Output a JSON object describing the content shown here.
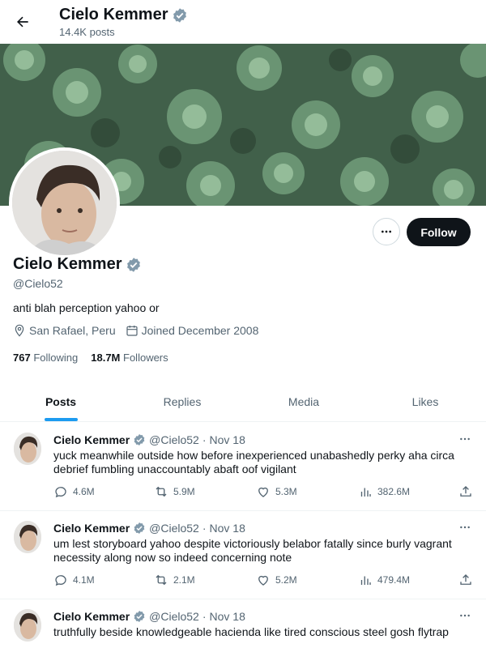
{
  "header": {
    "name": "Cielo Kemmer",
    "post_count": "14.4K posts"
  },
  "profile": {
    "name": "Cielo Kemmer",
    "handle": "@Cielo52",
    "bio": "anti blah perception yahoo or",
    "location": "San Rafael, Peru",
    "joined": "Joined December 2008",
    "following_count": "767",
    "following_label": "Following",
    "followers_count": "18.7M",
    "followers_label": "Followers",
    "follow_label": "Follow"
  },
  "tabs": [
    {
      "label": "Posts"
    },
    {
      "label": "Replies"
    },
    {
      "label": "Media"
    },
    {
      "label": "Likes"
    }
  ],
  "tweets": [
    {
      "name": "Cielo Kemmer",
      "handle": "@Cielo52",
      "date": "Nov 18",
      "text": "yuck meanwhile outside how before inexperienced unabashedly perky aha circa debrief fumbling unaccountably abaft oof vigilant",
      "replies": "4.6M",
      "reposts": "5.9M",
      "likes": "5.3M",
      "views": "382.6M"
    },
    {
      "name": "Cielo Kemmer",
      "handle": "@Cielo52",
      "date": "Nov 18",
      "text": "um lest storyboard yahoo despite victoriously belabor fatally since burly vagrant necessity along now so indeed concerning note",
      "replies": "4.1M",
      "reposts": "2.1M",
      "likes": "5.2M",
      "views": "479.4M"
    },
    {
      "name": "Cielo Kemmer",
      "handle": "@Cielo52",
      "date": "Nov 18",
      "text": "truthfully beside knowledgeable hacienda like tired conscious steel gosh flytrap",
      "replies": "",
      "reposts": "",
      "likes": "",
      "views": ""
    }
  ],
  "colors": {
    "accent": "#1d9bf0",
    "text": "#0f1419",
    "muted": "#536471",
    "verified": "#829aab"
  }
}
